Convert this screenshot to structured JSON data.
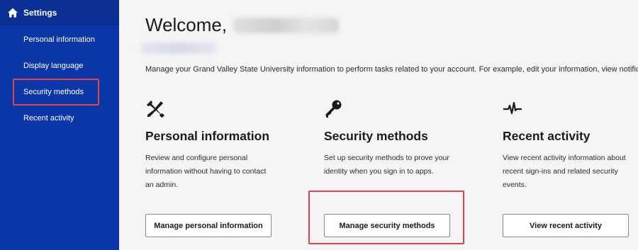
{
  "sidebar": {
    "header_label": "Settings",
    "items": [
      {
        "label": "Personal information"
      },
      {
        "label": "Display language"
      },
      {
        "label": "Security methods"
      },
      {
        "label": "Recent activity"
      }
    ]
  },
  "main": {
    "welcome": "Welcome,",
    "intro": "Manage your Grand Valley State University information to perform tasks related to your account. For example, edit your information, view notificati",
    "cards": [
      {
        "icon": "tools-icon",
        "title": "Personal information",
        "description": "Review and configure personal information without having to contact an admin.",
        "button": "Manage personal information"
      },
      {
        "icon": "key-icon",
        "title": "Security methods",
        "description": "Set up security methods to prove your identity when you sign in to apps.",
        "button": "Manage security methods"
      },
      {
        "icon": "activity-icon",
        "title": "Recent activity",
        "description": "View recent activity information about recent sign-ins and related security events.",
        "button": "View recent activity"
      }
    ]
  },
  "colors": {
    "sidebar": "#0a36a8",
    "highlight": "#e0454b",
    "background": "#f5f5f5"
  }
}
